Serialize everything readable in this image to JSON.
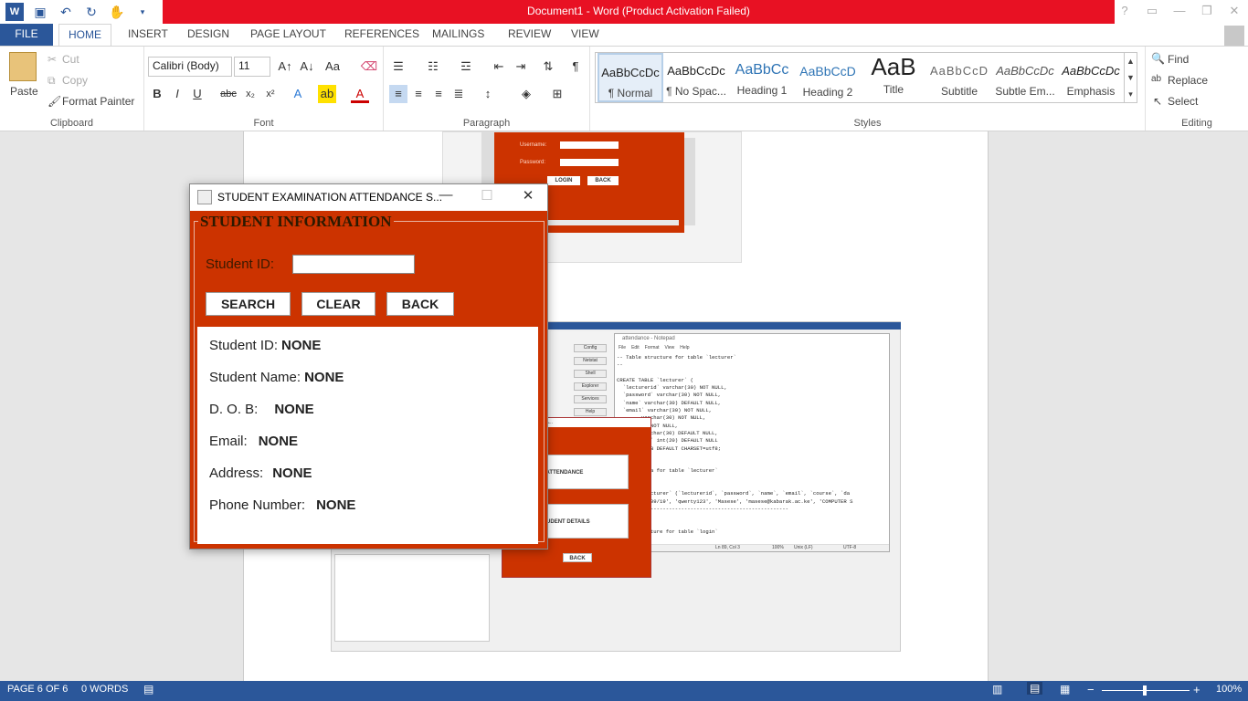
{
  "window": {
    "title": "Document1 -  Word (Product Activation Failed)"
  },
  "tabs": [
    "FILE",
    "HOME",
    "INSERT",
    "DESIGN",
    "PAGE LAYOUT",
    "REFERENCES",
    "MAILINGS",
    "REVIEW",
    "VIEW"
  ],
  "clipboard": {
    "paste": "Paste",
    "cut": "Cut",
    "copy": "Copy",
    "format_painter": "Format Painter",
    "label": "Clipboard"
  },
  "font": {
    "name": "Calibri (Body)",
    "size": "11",
    "label": "Font"
  },
  "paragraph": {
    "label": "Paragraph"
  },
  "styles": {
    "label": "Styles",
    "items": [
      {
        "sample": "AaBbCcDc",
        "name": "¶ Normal"
      },
      {
        "sample": "AaBbCcDc",
        "name": "¶ No Spac..."
      },
      {
        "sample": "AaBbCc",
        "name": "Heading 1"
      },
      {
        "sample": "AaBbCcD",
        "name": "Heading 2"
      },
      {
        "sample": "AaB",
        "name": "Title"
      },
      {
        "sample": "AaBbCcD",
        "name": "Subtitle"
      },
      {
        "sample": "AaBbCcDc",
        "name": "Subtle Em..."
      },
      {
        "sample": "AaBbCcDc",
        "name": "Emphasis"
      }
    ]
  },
  "editing": {
    "find": "Find",
    "replace": "Replace",
    "select": "Select",
    "label": "Editing"
  },
  "status": {
    "page": "PAGE 6 OF 6",
    "words": "0 WORDS",
    "zoom": "100%"
  },
  "dialog": {
    "title": "STUDENT EXAMINATION ATTENDANCE S...",
    "legend": "STUDENT INFORMATION",
    "id_label": "Student ID:",
    "id_value": "",
    "buttons": {
      "search": "SEARCH",
      "clear": "CLEAR",
      "back": "BACK"
    },
    "info": [
      {
        "label": "Student ID:",
        "value": "NONE"
      },
      {
        "label": "Student Name:",
        "value": "NONE"
      },
      {
        "label": "D. O. B:",
        "value": "NONE"
      },
      {
        "label": "Email:",
        "value": "NONE"
      },
      {
        "label": "Address:",
        "value": "NONE"
      },
      {
        "label": "Phone Number:",
        "value": "NONE"
      }
    ]
  },
  "embedded": {
    "login": {
      "username": "Username:",
      "password": "Password:",
      "login": "LOGIN",
      "back": "BACK"
    },
    "menu": {
      "title": "...NATION ATTENDA...",
      "attendance": "ATTENDANCE",
      "student_details": "STUDENT DETAILS",
      "back": "BACK"
    },
    "notepad": {
      "title": "attendance - Notepad",
      "menu": [
        "File",
        "Edit",
        "Format",
        "View",
        "Help"
      ],
      "lines": [
        "-- Table structure for table `lecturer`",
        "--",
        "",
        "CREATE TABLE `lecturer` (",
        "  `lecturerid` varchar(30) NOT NULL,",
        "  `password` varchar(30) NOT NULL,",
        "  `name` varchar(30) DEFAULT NULL,",
        "  `email` varchar(30) NOT NULL,",
        "        varchar(30) NOT NULL,",
        "        te NOT NULL,",
        "        varchar(30) DEFAULT NULL,",
        "        ber` int(20) DEFAULT NULL",
        "        noDB DEFAULT CHARSET=utf8;",
        "",
        "",
        "        data for table `lecturer`",
        "",
        "",
        "        `lecturer` (`lecturerid`, `password`, `name`, `email`, `course`, `da",
        "        01/09/19', 'qwerty123', 'Masese', 'masese@kabarak.ac.ke', 'COMPUTER S",
        "        ------------------------------------------------",
        "",
        "",
        "        ructure for table `login`"
      ],
      "status": [
        "Ln 89, Col 3",
        "100%",
        "Unix (LF)",
        "UTF-8"
      ]
    },
    "xampp_buttons": [
      "Config",
      "Netstat",
      "Shell",
      "Explorer",
      "Services",
      "Help"
    ]
  }
}
